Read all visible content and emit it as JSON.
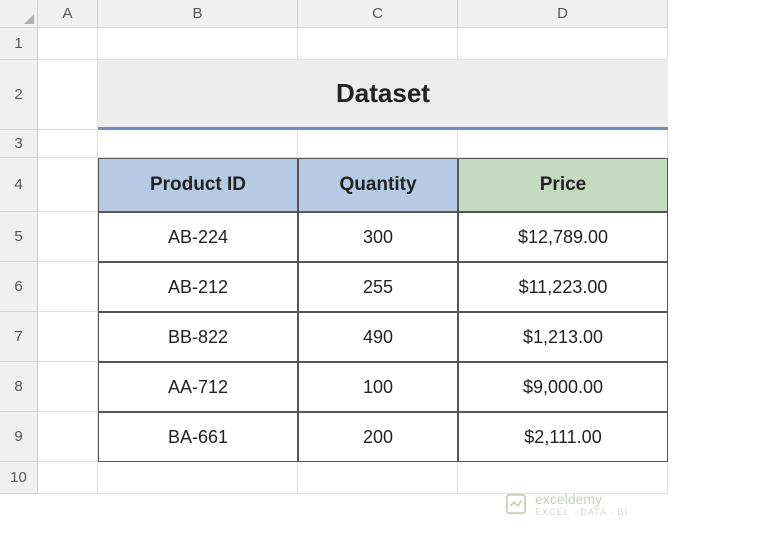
{
  "columns": [
    "A",
    "B",
    "C",
    "D"
  ],
  "rows": [
    "1",
    "2",
    "3",
    "4",
    "5",
    "6",
    "7",
    "8",
    "9",
    "10"
  ],
  "title": "Dataset",
  "headers": {
    "product_id": "Product ID",
    "quantity": "Quantity",
    "price": "Price"
  },
  "data": [
    {
      "product_id": "AB-224",
      "quantity": "300",
      "price": "$12,789.00"
    },
    {
      "product_id": "AB-212",
      "quantity": "255",
      "price": "$11,223.00"
    },
    {
      "product_id": "BB-822",
      "quantity": "490",
      "price": "$1,213.00"
    },
    {
      "product_id": "AA-712",
      "quantity": "100",
      "price": "$9,000.00"
    },
    {
      "product_id": "BA-661",
      "quantity": "200",
      "price": "$2,111.00"
    }
  ],
  "watermark": {
    "brand": "exceldemy",
    "tagline": "EXCEL · DATA · BI"
  }
}
